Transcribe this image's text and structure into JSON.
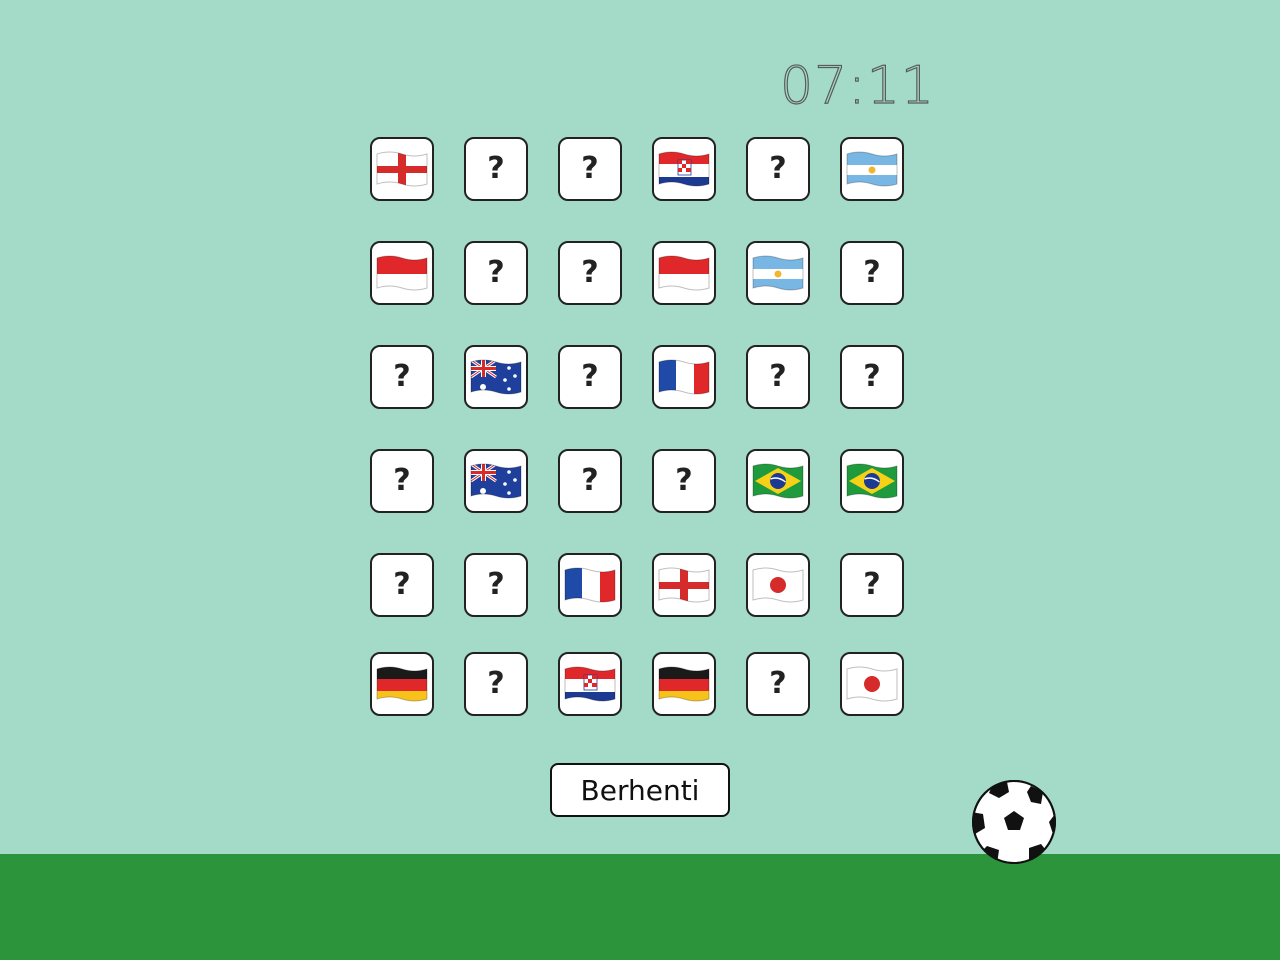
{
  "timer": "07:11",
  "hidden_symbol": "?",
  "stop_label": "Berhenti",
  "colors": {
    "background": "#a3dbc8",
    "grass": "#2c953c",
    "card": "#ffffff",
    "card_border": "#222222"
  },
  "cards": [
    [
      "flag-england",
      "hidden",
      "hidden",
      "flag-croatia",
      "hidden",
      "flag-argentina"
    ],
    [
      "flag-indonesia",
      "hidden",
      "hidden",
      "flag-indonesia",
      "flag-argentina",
      "hidden"
    ],
    [
      "hidden",
      "flag-australia",
      "hidden",
      "flag-france",
      "hidden",
      "hidden"
    ],
    [
      "hidden",
      "flag-australia",
      "hidden",
      "hidden",
      "flag-brazil",
      "flag-brazil"
    ],
    [
      "hidden",
      "hidden",
      "flag-france",
      "flag-england",
      "flag-japan",
      "hidden"
    ],
    [
      "flag-germany",
      "hidden",
      "flag-croatia",
      "flag-germany",
      "hidden",
      "flag-japan"
    ]
  ],
  "icons": {
    "ball": "soccer-ball-icon"
  }
}
